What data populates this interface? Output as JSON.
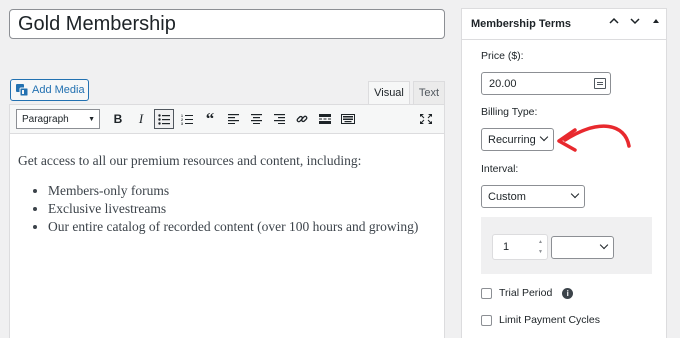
{
  "post": {
    "title": "Gold Membership"
  },
  "editor": {
    "add_media_label": "Add Media",
    "tab_visual": "Visual",
    "tab_text": "Text",
    "format_value": "Paragraph",
    "intro": "Get access to all our premium resources and content, including:",
    "bullets": [
      "Members-only forums",
      "Exclusive livestreams",
      "Our entire catalog of recorded content (over 100 hours and growing)"
    ]
  },
  "panel": {
    "title": "Membership Terms",
    "price_label": "Price ($):",
    "price_value": "20.00",
    "billing_label": "Billing Type:",
    "billing_value": "Recurring",
    "interval_label": "Interval:",
    "interval_value": "Custom",
    "interval_count": "1",
    "interval_unit": "",
    "trial_label": "Trial Period",
    "limit_label": "Limit Payment Cycles"
  },
  "colors": {
    "accent": "#2271b1",
    "annotation": "#e8292e"
  }
}
